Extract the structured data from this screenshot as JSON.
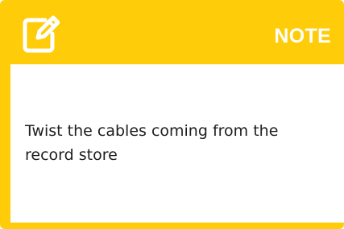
{
  "note": {
    "title": "NOTE",
    "text": "Twist the cables coming from the record store",
    "icon": "edit-icon"
  },
  "colors": {
    "accent": "#fecc09",
    "title_text": "#ffffff",
    "body_background": "#ffffff",
    "body_text": "#1f1f1f"
  }
}
